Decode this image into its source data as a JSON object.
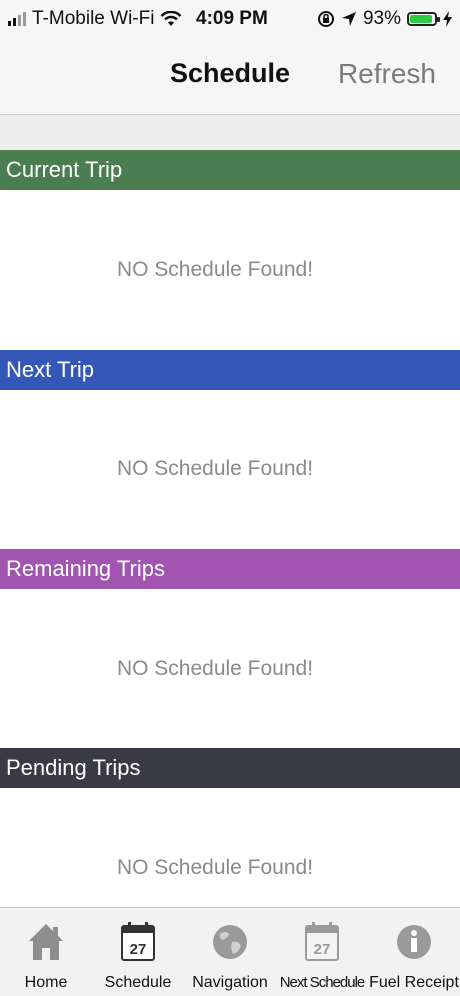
{
  "status_bar": {
    "carrier": "T-Mobile Wi-Fi",
    "time": "4:09 PM",
    "battery_percent": "93%",
    "battery_level": 0.93,
    "icons": [
      "signal-icon",
      "wifi-icon",
      "orientation-lock-icon",
      "location-icon",
      "battery-icon",
      "charging-icon"
    ]
  },
  "nav": {
    "title": "Schedule",
    "refresh_label": "Refresh"
  },
  "sections": [
    {
      "title": "Current Trip",
      "color": "#4a7d4f",
      "empty_text": "NO Schedule Found!"
    },
    {
      "title": "Next Trip",
      "color": "#3557b8",
      "empty_text": "NO Schedule Found!"
    },
    {
      "title": "Remaining Trips",
      "color": "#a154b0",
      "empty_text": "NO Schedule Found!"
    },
    {
      "title": "Pending Trips",
      "color": "#3a3b43",
      "empty_text": "NO Schedule Found!"
    }
  ],
  "tabs": [
    {
      "label": "Home",
      "icon": "home-icon"
    },
    {
      "label": "Schedule",
      "icon": "calendar-icon",
      "icon_text": "27",
      "selected": true
    },
    {
      "label": "Navigation",
      "icon": "globe-icon"
    },
    {
      "label": "Next Schedule",
      "icon": "calendar-icon",
      "icon_text": "27"
    },
    {
      "label": "Fuel Receipt",
      "icon": "info-icon"
    }
  ]
}
